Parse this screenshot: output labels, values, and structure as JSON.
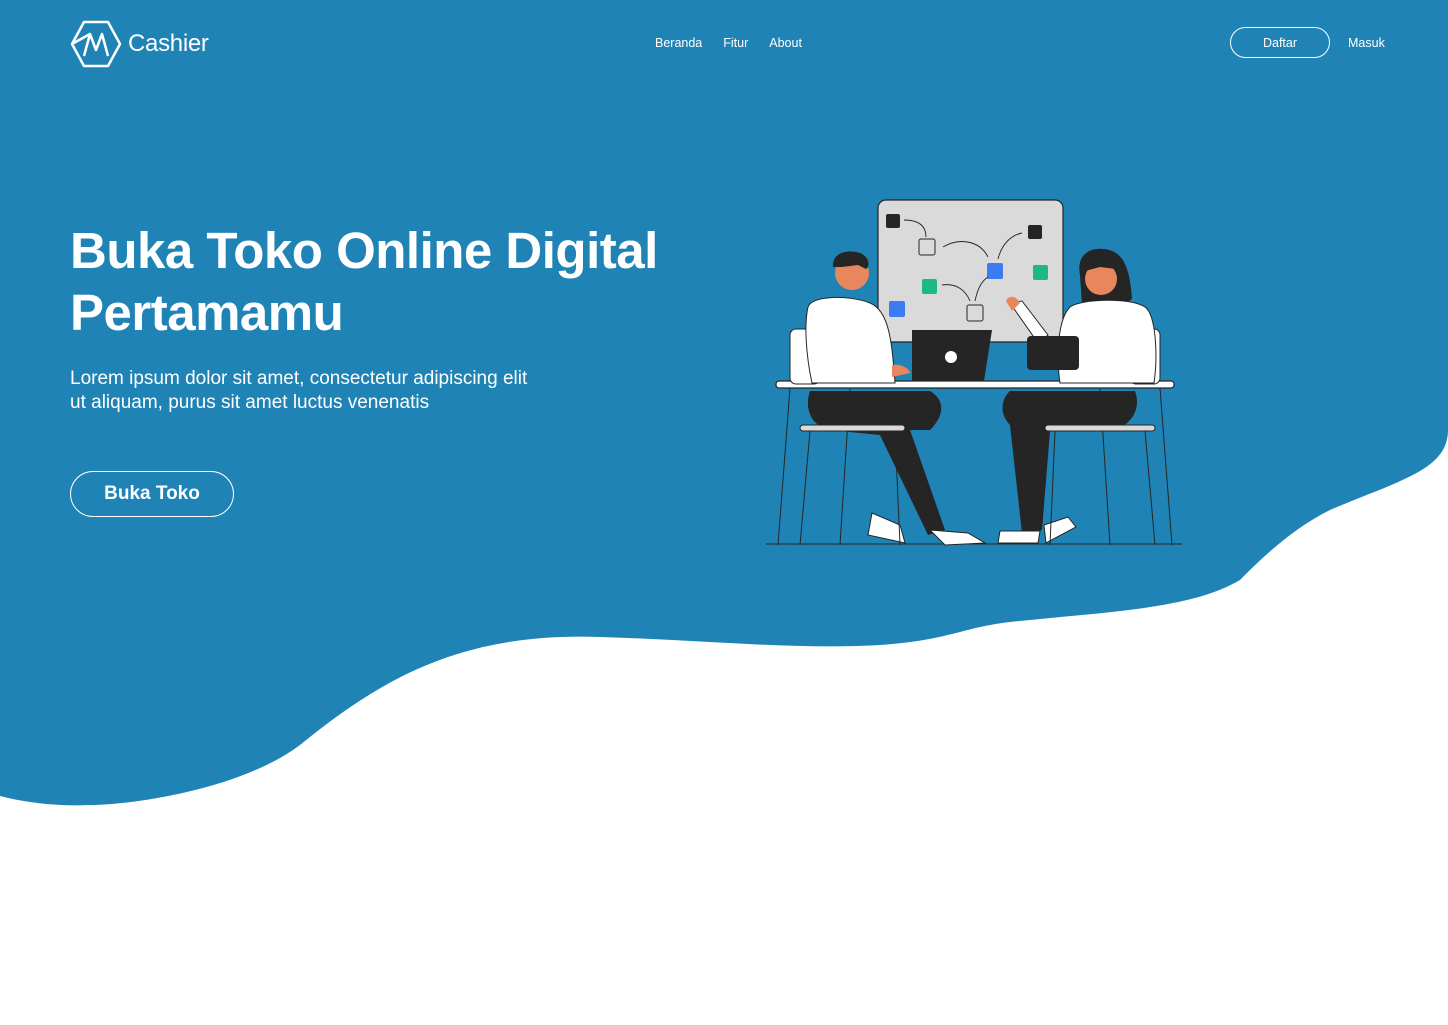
{
  "colors": {
    "hero_bg": "#2083B6",
    "text": "#FFFFFF",
    "page_bg": "#FFFFFF",
    "accent_blue": "#3B7CF0",
    "accent_green": "#1DB985",
    "skin": "#E8875E",
    "dark": "#252525"
  },
  "brand": {
    "name": "Cashier",
    "icon": "hexagon-logo-icon"
  },
  "nav": {
    "links": [
      "Beranda",
      "Fitur",
      "About"
    ],
    "register_label": "Daftar",
    "login_label": "Masuk"
  },
  "hero": {
    "title": "Buka Toko Online Digital Pertamamu",
    "description": "Lorem ipsum dolor sit amet, consectetur adipiscing elit ut aliquam, purus sit amet luctus venenatis",
    "cta_label": "Buka Toko",
    "illustration": "two-people-working-at-desk-illustration"
  }
}
